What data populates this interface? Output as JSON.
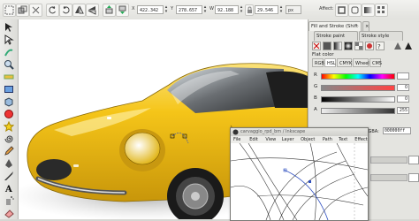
{
  "toolbar": {
    "x_label": "X",
    "x_value": "422.342",
    "y_label": "Y",
    "y_value": "278.657",
    "w_label": "W",
    "w_value": "92.188",
    "h_value": "29.546",
    "unit": "px",
    "affect_label": "Affect:"
  },
  "dock": {
    "tab_fill_stroke": "Fill and Stroke (Shift+Ctrl+F)",
    "tab_stroke_paint": "Stroke paint",
    "tab_stroke_style": "Stroke style",
    "fill_mode": "Flat color",
    "color_tabs": [
      "RGB",
      "HSL",
      "CMYK",
      "Wheel",
      "CMS"
    ],
    "channels": [
      {
        "label": "R",
        "value": "",
        "colors": [
          "#ff0000",
          "#ffff00",
          "#00ff00",
          "#00ffff",
          "#0000ff",
          "#ff00ff",
          "#ff0000"
        ]
      },
      {
        "label": "G",
        "value": "0",
        "colors": [
          "#888888",
          "#ff4444"
        ]
      },
      {
        "label": "B",
        "value": "0",
        "colors": [
          "#000000",
          "#ffffff"
        ]
      },
      {
        "label": "A",
        "value": "255",
        "colors": [
          "#eeeeee",
          "#333333"
        ]
      }
    ],
    "rgba_label": "RGBA:",
    "rgba_value": "000000ff"
  },
  "window": {
    "title": "carvaggio_rpd_bm / Inkscape",
    "menus": [
      "File",
      "Edit",
      "View",
      "Layer",
      "Object",
      "Path",
      "Text",
      "Effects",
      "Help"
    ]
  },
  "colors": {
    "car_body": "#f5c519",
    "car_shadow": "#c8960a",
    "window_glass": "#3a3a3a"
  }
}
